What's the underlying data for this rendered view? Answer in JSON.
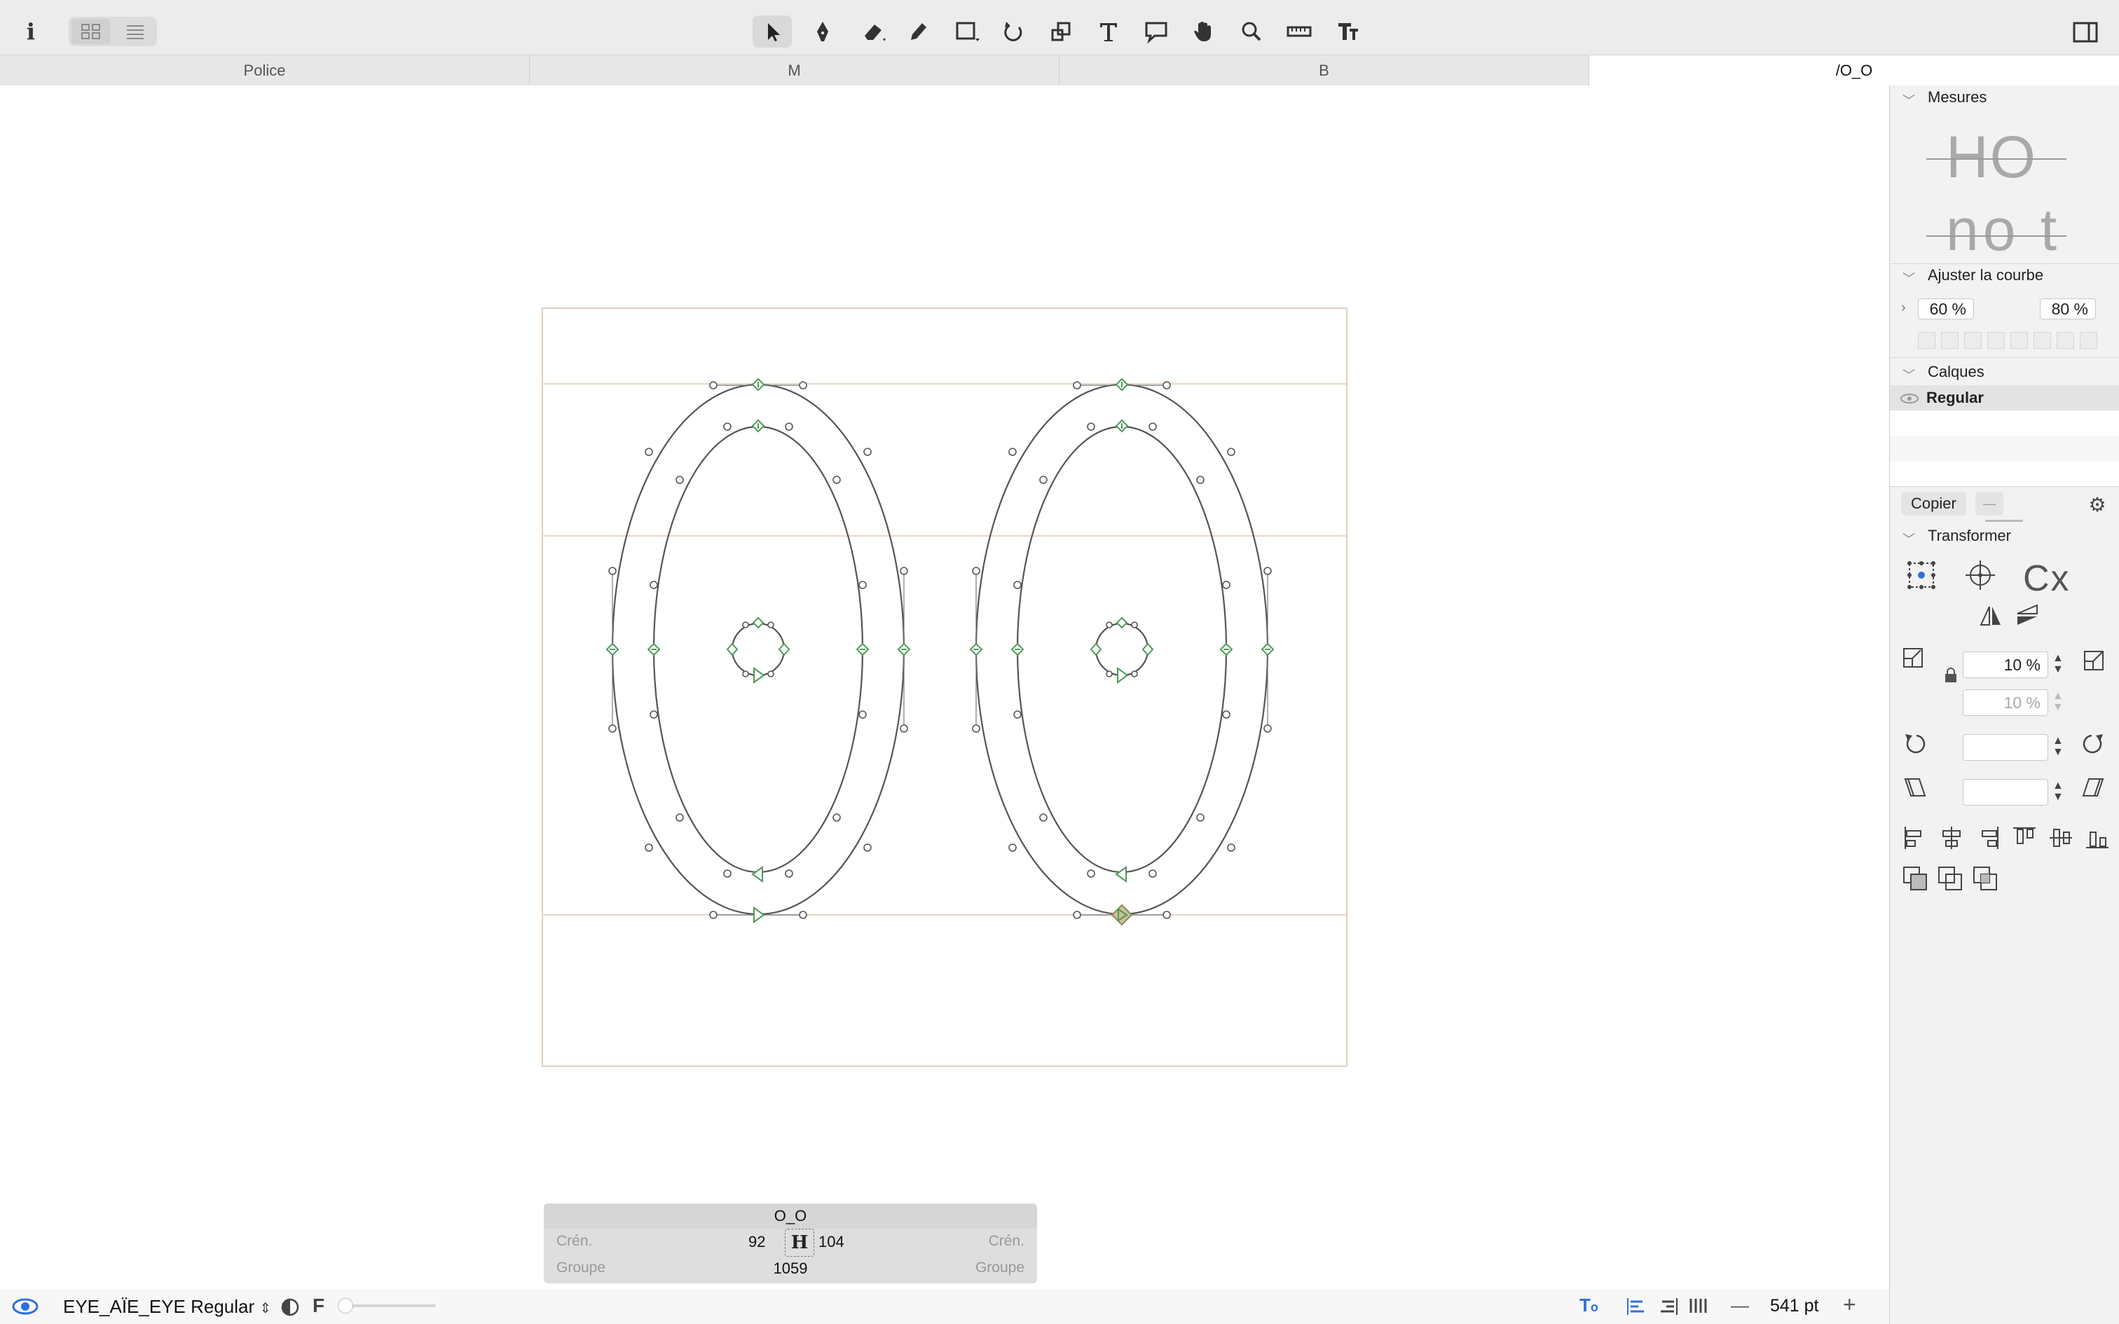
{
  "toolbar": {
    "info_label": "i",
    "tools": [
      "select-tool",
      "pen-tool",
      "eraser-tool",
      "pencil-tool",
      "rectangle-tool",
      "rotate-tool",
      "scale-tool",
      "text-tool",
      "annotation-tool",
      "hand-tool",
      "zoom-tool",
      "measure-tool",
      "type-tool"
    ]
  },
  "tabs": [
    {
      "label": "Police"
    },
    {
      "label": "M"
    },
    {
      "label": "B"
    },
    {
      "label": "/O_O"
    }
  ],
  "panel": {
    "measures": {
      "title": "Mesures",
      "preview_line1": "HO",
      "preview_line2": "no t"
    },
    "curve": {
      "title": "Ajuster la courbe",
      "value_left": "60 %",
      "value_right": "80 %"
    },
    "layers": {
      "title": "Calques",
      "items": [
        {
          "label": "Regular"
        }
      ]
    },
    "copy_label": "Copier",
    "copy_dash": "—",
    "transform": {
      "title": "Transformer",
      "cx_label": "Cx",
      "scale_x": "10 %",
      "scale_y": "10 %",
      "rotate": "",
      "slant": ""
    }
  },
  "kerning": {
    "glyph_name": "O_O",
    "left_label": "Crén.",
    "right_label": "Crén.",
    "left_value": "92",
    "right_value": "104",
    "group_left": "Groupe",
    "group_right": "Groupe",
    "width_value": "1059",
    "center_glyph": "H"
  },
  "status": {
    "font_name": "EYE_AÏE_EYE Regular",
    "f_label": "F",
    "zoom": "541 pt",
    "minus": "—",
    "plus": "+"
  },
  "colors": {
    "accent": "#2f6fdc",
    "guide": "#e8d6c4",
    "node_green": "#4e9a5a",
    "outline": "#555555"
  }
}
